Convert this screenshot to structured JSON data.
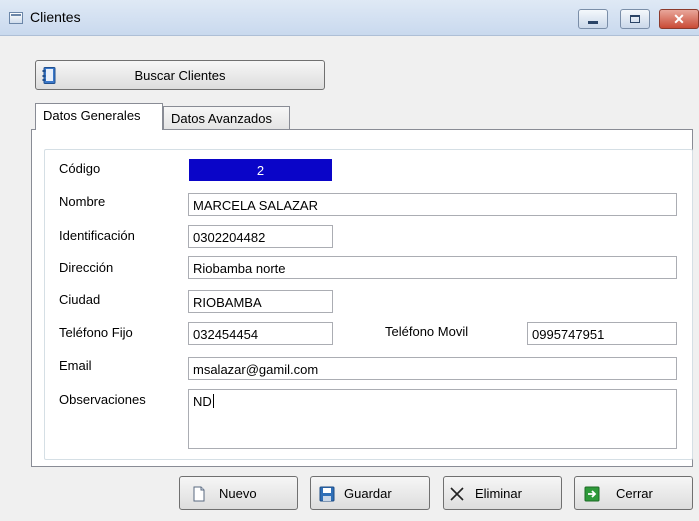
{
  "window": {
    "title": "Clientes",
    "close_glyph": "✕"
  },
  "toolbar": {
    "search_label": "Buscar Clientes"
  },
  "tabs": [
    {
      "label": "Datos Generales",
      "active": true
    },
    {
      "label": "Datos Avanzados",
      "active": false
    }
  ],
  "form": {
    "codigo": {
      "label": "Código",
      "value": "2"
    },
    "nombre": {
      "label": "Nombre",
      "value": "MARCELA SALAZAR"
    },
    "identificacion": {
      "label": "Identificación",
      "value": "0302204482"
    },
    "direccion": {
      "label": "Dirección",
      "value": "Riobamba norte"
    },
    "ciudad": {
      "label": "Ciudad",
      "value": "RIOBAMBA"
    },
    "telefono_fijo": {
      "label": "Teléfono Fijo",
      "value": "032454454"
    },
    "telefono_movil": {
      "label": "Teléfono Movil",
      "value": "0995747951"
    },
    "email": {
      "label": "Email",
      "value": "msalazar@gamil.com"
    },
    "observaciones": {
      "label": "Observaciones",
      "value": "ND"
    }
  },
  "actions": {
    "nuevo": "Nuevo",
    "guardar": "Guardar",
    "eliminar": "Eliminar",
    "cerrar": "Cerrar"
  },
  "icons": {
    "window": "window-app-icon",
    "search": "address-book-icon",
    "nuevo": "new-document-icon",
    "guardar": "save-disk-icon",
    "eliminar": "x-delete-icon",
    "cerrar": "exit-arrow-icon"
  },
  "colors": {
    "code_field_bg": "#0a05c8",
    "titlebar": "#c9d9ee",
    "close_button": "#c94b36"
  }
}
